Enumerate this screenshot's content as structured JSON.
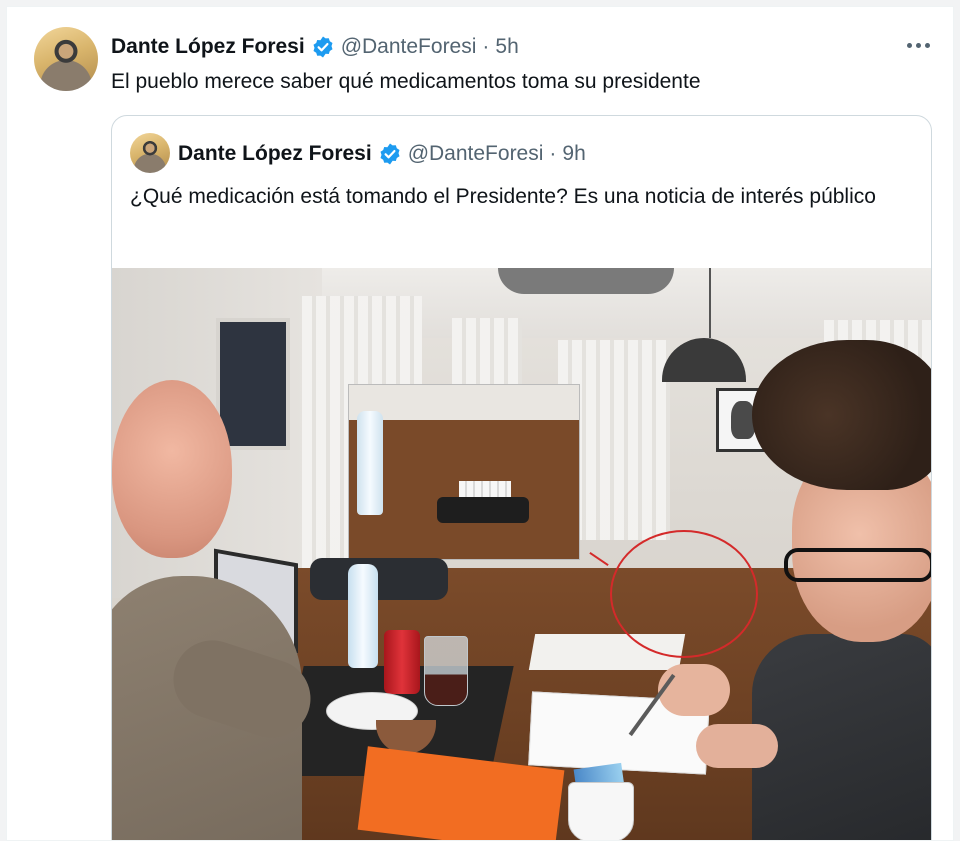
{
  "main_tweet": {
    "author_name": "Dante López Foresi",
    "handle": "@DanteForesi",
    "separator": "·",
    "time": "5h",
    "text": "El pueblo merece saber qué medicamentos toma su presidente"
  },
  "quoted_tweet": {
    "author_name": "Dante López Foresi",
    "handle": "@DanteForesi",
    "separator": "·",
    "time": "9h",
    "text": "¿Qué medicación está tomando el Presidente? Es una noticia de interés público"
  },
  "icons": {
    "verified": "verified-badge-icon",
    "more": "more-options-icon"
  },
  "colors": {
    "verified": "#1d9bf0",
    "secondary_text": "#536471",
    "annotation": "#d42a2a"
  }
}
